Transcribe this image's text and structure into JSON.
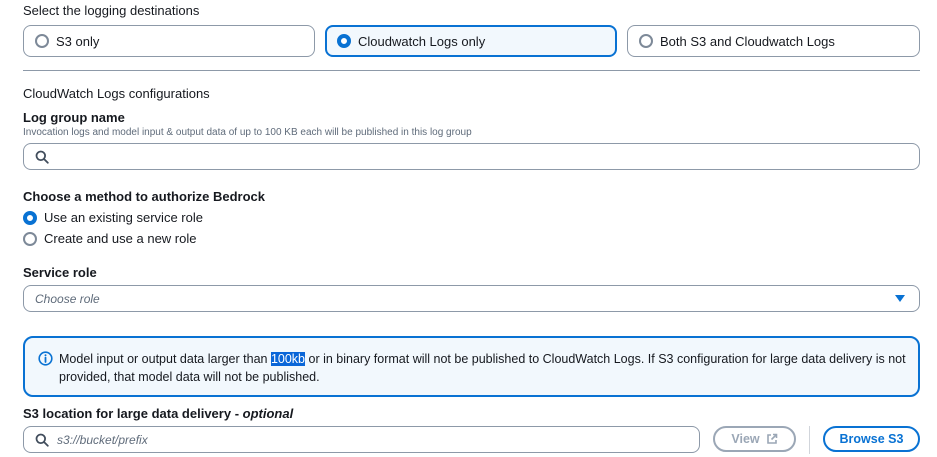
{
  "destinations": {
    "title": "Select the logging destinations",
    "options": [
      {
        "label": "S3 only",
        "selected": false
      },
      {
        "label": "Cloudwatch Logs only",
        "selected": true
      },
      {
        "label": "Both S3 and Cloudwatch Logs",
        "selected": false
      }
    ]
  },
  "cloudwatch": {
    "section_title": "CloudWatch Logs configurations",
    "log_group": {
      "label": "Log group name",
      "description": "Invocation logs and model input & output data of up to 100 KB each will be published in this log group",
      "value": ""
    }
  },
  "auth": {
    "label": "Choose a method to authorize Bedrock",
    "options": [
      {
        "label": "Use an existing service role",
        "selected": true
      },
      {
        "label": "Create and use a new role",
        "selected": false
      }
    ]
  },
  "service_role": {
    "label": "Service role",
    "placeholder": "Choose role"
  },
  "alert": {
    "text_before": "Model input or output data larger than ",
    "highlight": "100kb",
    "text_after": " or in binary format will not be published to CloudWatch Logs. If S3 configuration for large data delivery is not provided, that model data will not be published."
  },
  "s3_location": {
    "label": "S3 location for large data delivery",
    "label_sep": " - ",
    "optional": "optional",
    "placeholder": "s3://bucket/prefix",
    "view_label": "View",
    "browse_label": "Browse S3"
  },
  "colors": {
    "accent": "#0972d3",
    "border": "#8d99a8",
    "info_bg": "#f2f8fd",
    "disabled": "#9ba7b6"
  },
  "icons": [
    "search-icon",
    "caret-down-icon",
    "info-icon",
    "external-link-icon"
  ]
}
